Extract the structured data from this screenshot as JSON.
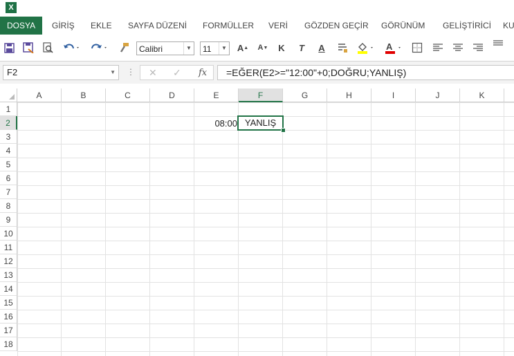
{
  "app": {
    "logo_letter": "X"
  },
  "tabs": [
    "DOSYA",
    "GİRİŞ",
    "EKLE",
    "SAYFA DÜZENİ",
    "FORMÜLLER",
    "VERİ",
    "GÖZDEN GEÇİR",
    "GÖRÜNÜM",
    "GELİŞTİRİCİ",
    "KU"
  ],
  "ribbon": {
    "font_name": "Calibri",
    "font_size": "11"
  },
  "formula_bar": {
    "name_box": "F2",
    "formula": "=EĞER(E2>=\"12:00\"+0;DOĞRU;YANLIŞ)"
  },
  "columns": [
    "A",
    "B",
    "C",
    "D",
    "E",
    "F",
    "G",
    "H",
    "I",
    "J",
    "K"
  ],
  "rows": [
    "1",
    "2",
    "3",
    "4",
    "5",
    "6",
    "7",
    "8",
    "9",
    "10",
    "11",
    "12",
    "13",
    "14",
    "15",
    "16",
    "17",
    "18"
  ],
  "cells": {
    "E2": "08:00",
    "F2": "YANLIŞ"
  },
  "colors": {
    "accent": "#217346"
  }
}
